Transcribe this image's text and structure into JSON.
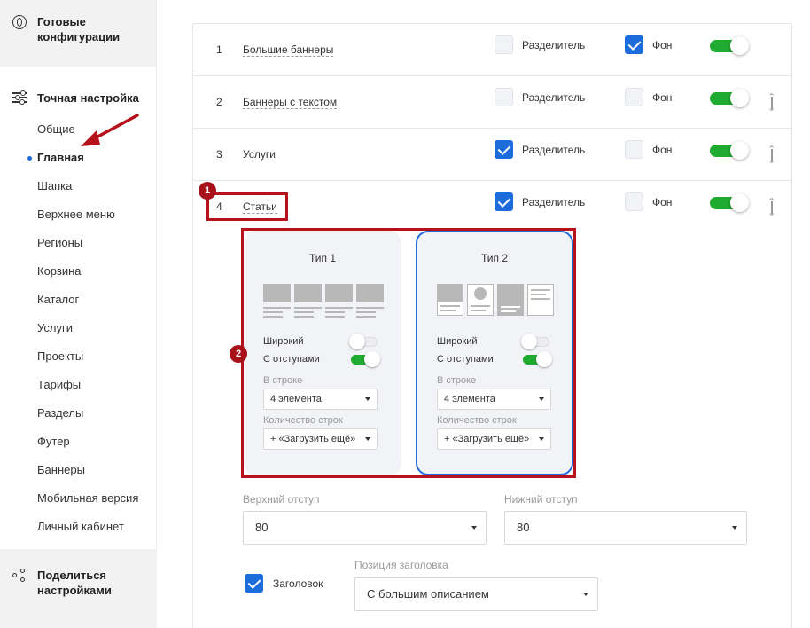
{
  "sidebar": {
    "top_section": "Готовые конфигурации",
    "section_title": "Точная настройка",
    "items": [
      {
        "label": "Общие",
        "active": false
      },
      {
        "label": "Главная",
        "active": true
      },
      {
        "label": "Шапка",
        "active": false
      },
      {
        "label": "Верхнее меню",
        "active": false
      },
      {
        "label": "Регионы",
        "active": false
      },
      {
        "label": "Корзина",
        "active": false
      },
      {
        "label": "Каталог",
        "active": false
      },
      {
        "label": "Услуги",
        "active": false
      },
      {
        "label": "Проекты",
        "active": false
      },
      {
        "label": "Тарифы",
        "active": false
      },
      {
        "label": "Разделы",
        "active": false
      },
      {
        "label": "Футер",
        "active": false
      },
      {
        "label": "Баннеры",
        "active": false
      },
      {
        "label": "Мобильная версия",
        "active": false
      },
      {
        "label": "Личный кабинет",
        "active": false
      }
    ],
    "bottom_section": "Поделиться настройками"
  },
  "blocks": [
    {
      "num": "1",
      "name": "Большие баннеры",
      "separator_label": "Разделитель",
      "separator": false,
      "bg_label": "Фон",
      "bg": true,
      "enabled": true
    },
    {
      "num": "2",
      "name": "Баннеры с текстом",
      "separator_label": "Разделитель",
      "separator": false,
      "bg_label": "Фон",
      "bg": false,
      "enabled": true
    },
    {
      "num": "3",
      "name": "Услуги",
      "separator_label": "Разделитель",
      "separator": true,
      "bg_label": "Фон",
      "bg": false,
      "enabled": true
    },
    {
      "num": "4",
      "name": "Статьи",
      "separator_label": "Разделитель",
      "separator": true,
      "bg_label": "Фон",
      "bg": false,
      "enabled": true
    }
  ],
  "annotations": {
    "badge1": "1",
    "badge2": "2"
  },
  "types": [
    {
      "title": "Тип 1",
      "selected": false,
      "wide_label": "Широкий",
      "wide": false,
      "padding_label": "С отступами",
      "padding": true,
      "per_row_label": "В строке",
      "per_row_value": "4 элемента",
      "rows_label": "Количество строк",
      "rows_value": "+ «Загрузить ещё»"
    },
    {
      "title": "Тип 2",
      "selected": true,
      "wide_label": "Широкий",
      "wide": false,
      "padding_label": "С отступами",
      "padding": true,
      "per_row_label": "В строке",
      "per_row_value": "4 элемента",
      "rows_label": "Количество строк",
      "rows_value": "+ «Загрузить ещё»"
    }
  ],
  "spacing": {
    "top_label": "Верхний отступ",
    "top_value": "80",
    "bottom_label": "Нижний отступ",
    "bottom_value": "80"
  },
  "header_opt": {
    "label": "Заголовок",
    "checked": true,
    "position_label": "Позиция заголовка",
    "position_value": "С большим описанием"
  },
  "colors": {
    "accent": "#1c6cdc",
    "toggle_on": "#1fab2f",
    "annotation": "#b5121b"
  }
}
